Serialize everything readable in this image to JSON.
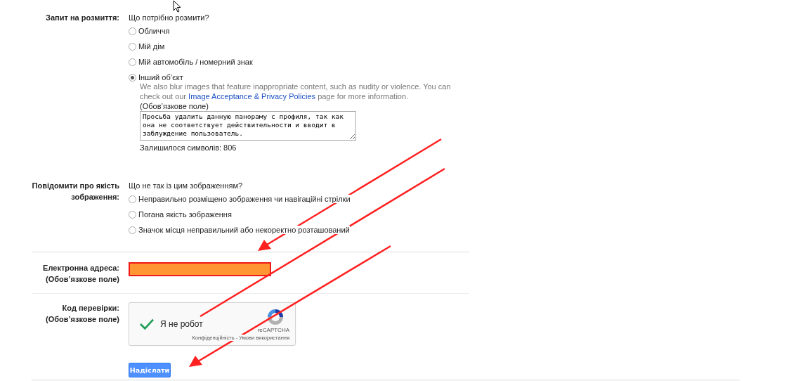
{
  "blur_request": {
    "label": "Запит на розмиття:",
    "question": "Що потрібно розмити?",
    "options": [
      {
        "label": "Обличчя",
        "selected": false
      },
      {
        "label": "Мій дім",
        "selected": false
      },
      {
        "label": "Мій автомобіль / номерний знак",
        "selected": false
      },
      {
        "label": "Інший об’єкт",
        "selected": true
      }
    ],
    "note_before": "We also blur images that feature inappropriate content, such as nudity or violence. You can check out our",
    "note_link": "Image Acceptance & Privacy Policies",
    "note_after": "page for more information.",
    "required_note": "(Обов’язкове поле)",
    "text": "Просьба удалить данную панораму с профиля, так как она не соответствует действительности и вводит в заблуждение пользователь.",
    "remaining": "Залишилося символів: 806"
  },
  "quality_report": {
    "label": "Повідомити про якість зображення:",
    "question": "Що не так із цим зображенням?",
    "options": [
      {
        "label": "Неправильно розміщено зображення чи навігаційні стрілки",
        "selected": false
      },
      {
        "label": "Погана якість зображення",
        "selected": false
      },
      {
        "label": "Значок місця неправильний або некоректно розташований",
        "selected": false
      }
    ]
  },
  "email": {
    "label": "Електронна адреса:",
    "required": "(Обов’язкове поле)"
  },
  "captcha": {
    "label": "Код перевірки:",
    "required": "(Обов’язкове поле)",
    "checkbox_label": "Я не робот",
    "checked": true,
    "brand": "reCAPTCHA",
    "links": "Конфіденційність - Умови використання"
  },
  "submit": "Надіслати"
}
